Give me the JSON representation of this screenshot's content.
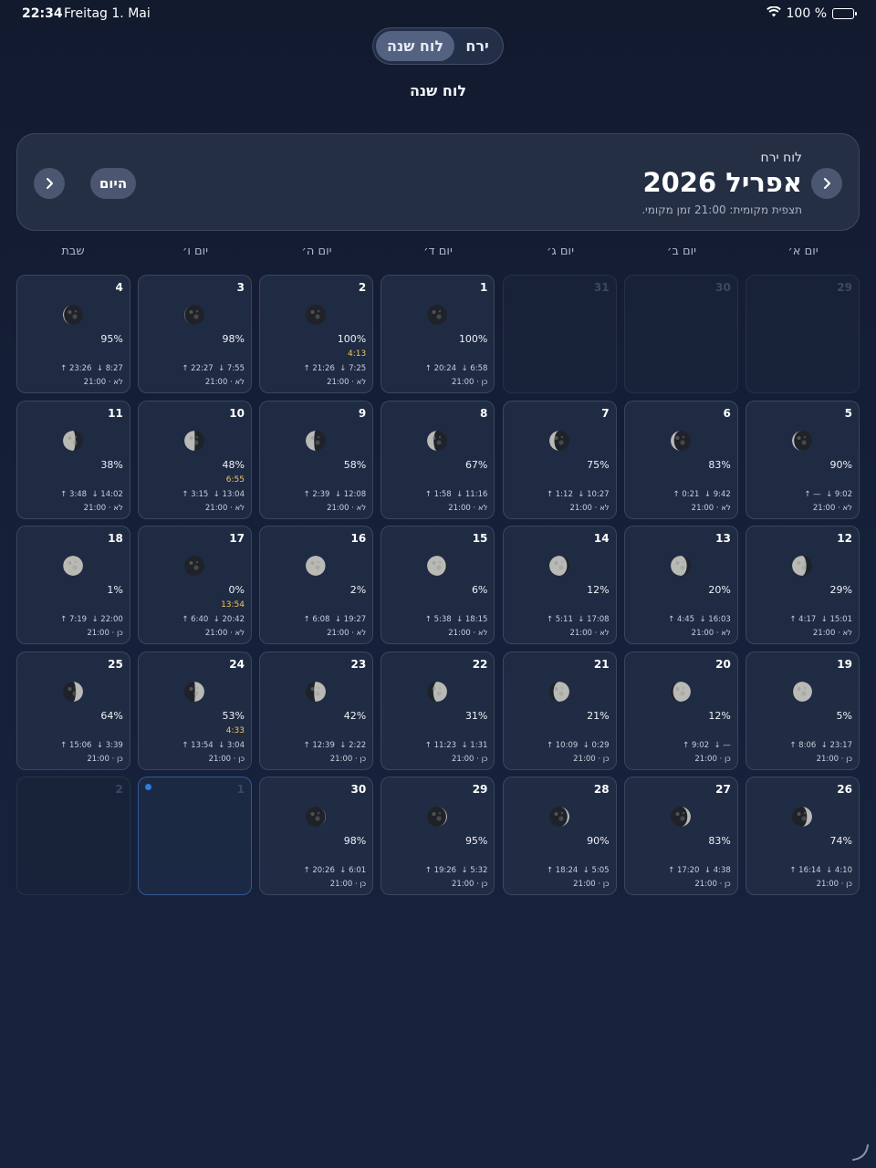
{
  "status": {
    "time": "22:34",
    "date": "Freitag 1. Mai",
    "battery": "100 %"
  },
  "segment": {
    "moon": "ירח",
    "calendar": "לוח שנה"
  },
  "subtitle": "לוח שנה",
  "header": {
    "label": "לוח ירח",
    "title": "אפריל 2026",
    "note": "תצפית מקומית: 21:00 זמן מקומי.",
    "today": "היום"
  },
  "weekdays": [
    "יום א׳",
    "יום ב׳",
    "יום ג׳",
    "יום ד׳",
    "יום ה׳",
    "יום ו׳",
    "שבת"
  ],
  "colors": {
    "accent": "#2c7be5",
    "peak": "#f2c35a"
  },
  "weeks": [
    [
      {
        "day": "29",
        "out": true
      },
      {
        "day": "30",
        "out": true
      },
      {
        "day": "31",
        "out": true
      },
      {
        "day": "1",
        "illum": 100,
        "pct": "100%",
        "rise": "20:24",
        "set": "6:58",
        "vis": "כן · 21:00",
        "waxing": false
      },
      {
        "day": "2",
        "illum": 100,
        "pct": "100%",
        "peak": "4:13",
        "rise": "21:26",
        "set": "7:25",
        "vis": "לא · 21:00",
        "waxing": false
      },
      {
        "day": "3",
        "illum": 98,
        "pct": "98%",
        "rise": "22:27",
        "set": "7:55",
        "vis": "לא · 21:00",
        "waxing": false
      },
      {
        "day": "4",
        "illum": 95,
        "pct": "95%",
        "rise": "23:26",
        "set": "8:27",
        "vis": "לא · 21:00",
        "waxing": false
      }
    ],
    [
      {
        "day": "5",
        "illum": 90,
        "pct": "90%",
        "rise": "—",
        "set": "9:02",
        "vis": "לא · 21:00",
        "waxing": false
      },
      {
        "day": "6",
        "illum": 83,
        "pct": "83%",
        "rise": "0:21",
        "set": "9:42",
        "vis": "לא · 21:00",
        "waxing": false
      },
      {
        "day": "7",
        "illum": 75,
        "pct": "75%",
        "rise": "1:12",
        "set": "10:27",
        "vis": "לא · 21:00",
        "waxing": false
      },
      {
        "day": "8",
        "illum": 67,
        "pct": "67%",
        "rise": "1:58",
        "set": "11:16",
        "vis": "לא · 21:00",
        "waxing": false
      },
      {
        "day": "9",
        "illum": 58,
        "pct": "58%",
        "rise": "2:39",
        "set": "12:08",
        "vis": "לא · 21:00",
        "waxing": false
      },
      {
        "day": "10",
        "illum": 48,
        "pct": "48%",
        "peak": "6:55",
        "rise": "3:15",
        "set": "13:04",
        "vis": "לא · 21:00",
        "waxing": false
      },
      {
        "day": "11",
        "illum": 38,
        "pct": "38%",
        "rise": "3:48",
        "set": "14:02",
        "vis": "לא · 21:00",
        "waxing": false
      }
    ],
    [
      {
        "day": "12",
        "illum": 29,
        "pct": "29%",
        "rise": "4:17",
        "set": "15:01",
        "vis": "לא · 21:00",
        "waxing": false
      },
      {
        "day": "13",
        "illum": 20,
        "pct": "20%",
        "rise": "4:45",
        "set": "16:03",
        "vis": "לא · 21:00",
        "waxing": false
      },
      {
        "day": "14",
        "illum": 12,
        "pct": "12%",
        "rise": "5:11",
        "set": "17:08",
        "vis": "לא · 21:00",
        "waxing": false
      },
      {
        "day": "15",
        "illum": 6,
        "pct": "6%",
        "rise": "5:38",
        "set": "18:15",
        "vis": "לא · 21:00",
        "waxing": false
      },
      {
        "day": "16",
        "illum": 2,
        "pct": "2%",
        "rise": "6:08",
        "set": "19:27",
        "vis": "לא · 21:00",
        "waxing": false
      },
      {
        "day": "17",
        "illum": 0,
        "pct": "0%",
        "peak": "13:54",
        "rise": "6:40",
        "set": "20:42",
        "vis": "לא · 21:00",
        "waxing": true
      },
      {
        "day": "18",
        "illum": 1,
        "pct": "1%",
        "rise": "7:19",
        "set": "22:00",
        "vis": "כן · 21:00",
        "waxing": true
      }
    ],
    [
      {
        "day": "19",
        "illum": 5,
        "pct": "5%",
        "rise": "8:06",
        "set": "23:17",
        "vis": "כן · 21:00",
        "waxing": true
      },
      {
        "day": "20",
        "illum": 12,
        "pct": "12%",
        "rise": "9:02",
        "set": "—",
        "vis": "כן · 21:00",
        "waxing": true
      },
      {
        "day": "21",
        "illum": 21,
        "pct": "21%",
        "rise": "10:09",
        "set": "0:29",
        "vis": "כן · 21:00",
        "waxing": true
      },
      {
        "day": "22",
        "illum": 31,
        "pct": "31%",
        "rise": "11:23",
        "set": "1:31",
        "vis": "כן · 21:00",
        "waxing": true
      },
      {
        "day": "23",
        "illum": 42,
        "pct": "42%",
        "rise": "12:39",
        "set": "2:22",
        "vis": "כן · 21:00",
        "waxing": true
      },
      {
        "day": "24",
        "illum": 53,
        "pct": "53%",
        "peak": "4:33",
        "rise": "13:54",
        "set": "3:04",
        "vis": "כן · 21:00",
        "waxing": true
      },
      {
        "day": "25",
        "illum": 64,
        "pct": "64%",
        "rise": "15:06",
        "set": "3:39",
        "vis": "כן · 21:00",
        "waxing": true
      }
    ],
    [
      {
        "day": "26",
        "illum": 74,
        "pct": "74%",
        "rise": "16:14",
        "set": "4:10",
        "vis": "כן · 21:00",
        "waxing": true
      },
      {
        "day": "27",
        "illum": 83,
        "pct": "83%",
        "rise": "17:20",
        "set": "4:38",
        "vis": "כן · 21:00",
        "waxing": true
      },
      {
        "day": "28",
        "illum": 90,
        "pct": "90%",
        "rise": "18:24",
        "set": "5:05",
        "vis": "כן · 21:00",
        "waxing": true
      },
      {
        "day": "29",
        "illum": 95,
        "pct": "95%",
        "rise": "19:26",
        "set": "5:32",
        "vis": "כן · 21:00",
        "waxing": true
      },
      {
        "day": "30",
        "illum": 98,
        "pct": "98%",
        "rise": "20:26",
        "set": "6:01",
        "vis": "כן · 21:00",
        "waxing": true
      },
      {
        "day": "1",
        "out": true,
        "today": true
      },
      {
        "day": "2",
        "out": true
      }
    ]
  ]
}
